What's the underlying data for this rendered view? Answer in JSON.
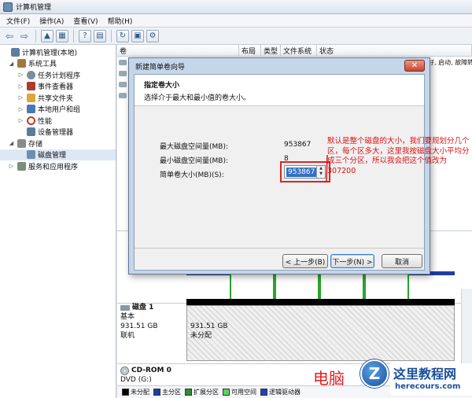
{
  "window": {
    "title": "计算机管理"
  },
  "menu": [
    "文件(F)",
    "操作(A)",
    "查看(V)",
    "帮助(H)"
  ],
  "tree": [
    {
      "label": "计算机管理(本地)",
      "level": 0,
      "icon": "computer-icon",
      "color": "#5d7ea3"
    },
    {
      "label": "系统工具",
      "level": 1,
      "icon": "tools-icon",
      "color": "#a07a3c"
    },
    {
      "label": "任务计划程序",
      "level": 2,
      "icon": "clock-icon",
      "color": "#7a8f9c"
    },
    {
      "label": "事件查看器",
      "level": 2,
      "icon": "event-viewer-icon",
      "color": "#b03a2e"
    },
    {
      "label": "共享文件夹",
      "level": 2,
      "icon": "shared-folder-icon",
      "color": "#d8a93a"
    },
    {
      "label": "本地用户和组",
      "level": 2,
      "icon": "users-icon",
      "color": "#4a78b5"
    },
    {
      "label": "性能",
      "level": 2,
      "icon": "performance-icon",
      "color": "#c0392b"
    },
    {
      "label": "设备管理器",
      "level": 2,
      "icon": "device-manager-icon",
      "color": "#5b7c99"
    },
    {
      "label": "存储",
      "level": 1,
      "icon": "storage-icon",
      "color": "#8a8a8a"
    },
    {
      "label": "磁盘管理",
      "level": 2,
      "icon": "disk-icon",
      "color": "#6b8fb3"
    },
    {
      "label": "服务和应用程序",
      "level": 1,
      "icon": "services-icon",
      "color": "#7a8f7a"
    }
  ],
  "list": {
    "columns": [
      "卷",
      "布局",
      "类型",
      "文件系统",
      "状态"
    ],
    "row_fragment": "好, 启动, 故障转储"
  },
  "wizard": {
    "title": "新建简单卷向导",
    "heading": "指定卷大小",
    "subheading": "选择介于最大和最小值的卷大小。",
    "max_label": "最大磁盘空间量(MB):",
    "max_value": "953867",
    "min_label": "最小磁盘空间量(MB):",
    "min_value": "8",
    "size_label": "简单卷大小(MB)(S):",
    "size_value": "953867",
    "back_button": "< 上一步(B)",
    "next_button": "下一步(N) >",
    "cancel_button": "取消"
  },
  "annotation": "默认是整个磁盘的大小，我们要规划分几个区，每个区多大，这里我按磁盘大小平均分成三个分区，所以我会把这个值改为307200",
  "disks": [
    {
      "name": "磁盘 1",
      "type": "基本",
      "size": "931.51 GB",
      "status": "联机",
      "partition_size": "931.51 GB",
      "partition_state": "未分配"
    },
    {
      "name": "CD-ROM 0",
      "type": "DVD (G:)"
    }
  ],
  "legend": [
    {
      "label": "未分配",
      "color": "#000000"
    },
    {
      "label": "主分区",
      "color": "#1d3f9e"
    },
    {
      "label": "扩展分区",
      "color": "#2f8f2f"
    },
    {
      "label": "可用空间",
      "color": "#5fcf5f"
    },
    {
      "label": "逻辑驱动器",
      "color": "#2040c0"
    }
  ],
  "watermark": {
    "text": "电脑",
    "site_name": "这里教程网",
    "url": "herecours.com"
  }
}
